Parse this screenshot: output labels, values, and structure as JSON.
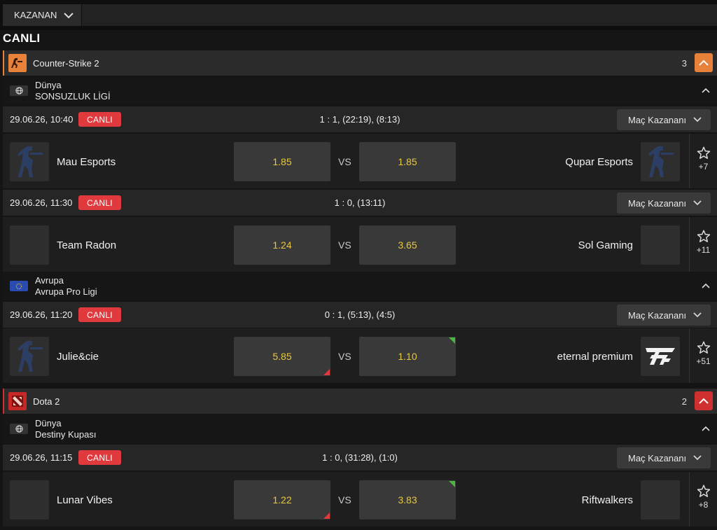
{
  "filter": {
    "label": "KAZANAN"
  },
  "page_title": "CANLI",
  "market_label": "Maç Kazananı",
  "vs_label": "VS",
  "colors": {
    "live": "#e03a3e",
    "odd_text": "#e8c83e",
    "cs2_accent": "#e8813a",
    "dota_accent": "#d03030",
    "up": "#4bb543",
    "down": "#e03a3e"
  },
  "sports": [
    {
      "name": "Counter-Strike 2",
      "count": "3",
      "icon": "cs2-icon",
      "leagues": [
        {
          "region": "Dünya",
          "name": "SONSUZLUK LİGİ",
          "flag": "globe-icon",
          "matches": [
            {
              "time": "29.06.26, 10:40",
              "live": "CANLI",
              "score": "1 : 1, (22:19), (8:13)",
              "home": "Mau Esports",
              "away": "Qupar Esports",
              "odd_home": "1.85",
              "odd_away": "1.85",
              "more": "+7"
            },
            {
              "time": "29.06.26, 11:30",
              "live": "CANLI",
              "score": "1 : 0, (13:11)",
              "home": "Team Radon",
              "away": "Sol Gaming",
              "odd_home": "1.24",
              "odd_away": "3.65",
              "more": "+11"
            }
          ]
        },
        {
          "region": "Avrupa",
          "name": "Avrupa Pro Ligi",
          "flag": "eu-flag-icon",
          "matches": [
            {
              "time": "29.06.26, 11:20",
              "live": "CANLI",
              "score": "0 : 1, (5:13), (4:5)",
              "home": "Julie&cie",
              "away": "eternal premium",
              "odd_home": "5.85",
              "odd_away": "1.10",
              "more": "+51"
            }
          ]
        }
      ]
    },
    {
      "name": "Dota 2",
      "count": "2",
      "icon": "dota2-icon",
      "leagues": [
        {
          "region": "Dünya",
          "name": "Destiny Kupası",
          "flag": "globe-icon",
          "matches": [
            {
              "time": "29.06.26, 11:15",
              "live": "CANLI",
              "score": "1 : 0, (31:28), (1:0)",
              "home": "Lunar Vibes",
              "away": "Riftwalkers",
              "odd_home": "1.22",
              "odd_away": "3.83",
              "more": "+8"
            }
          ]
        }
      ]
    }
  ]
}
